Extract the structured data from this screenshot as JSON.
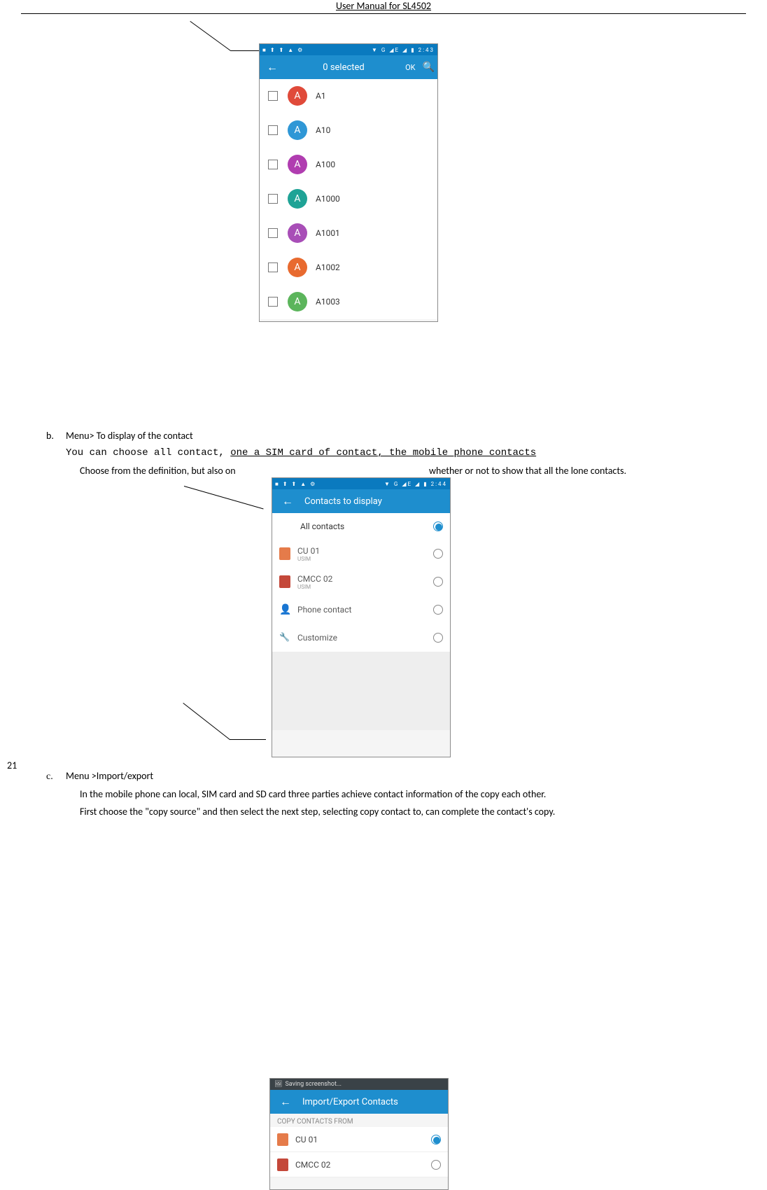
{
  "header": {
    "title": "User Manual for SL4502"
  },
  "pageNumber": "21",
  "section_b": {
    "marker": "b.",
    "heading": "Menu> To display of the contact",
    "line1": "You can choose all contact, ",
    "line1_underlined": "one a SIM card of contact, the mobile phone contacts",
    "line2_start": "Choose from the definition, but also on",
    "line2_end": " whether or not to show that all the lone contacts."
  },
  "section_c": {
    "marker": "c.",
    "heading": "Menu >Import/export",
    "p1": "In the mobile phone can local, SIM card and SD card three parties achieve contact information of the copy each other.",
    "p2": "First choose the \"copy source\" and then select the next step, selecting copy contact to, can complete the contact's copy."
  },
  "phone1": {
    "status_left": "■ ⬆ ⬆ ▲ ⚙",
    "status_right": "▼ G ◢E ◢ ▮ 2:43",
    "appbar": {
      "back": "←",
      "title": "0 selected",
      "ok": "OK",
      "search": "🔍"
    },
    "rows": [
      {
        "color": "#e04a3a",
        "initial": "A",
        "name": "A1"
      },
      {
        "color": "#2f97d6",
        "initial": "A",
        "name": "A10"
      },
      {
        "color": "#b03db0",
        "initial": "A",
        "name": "A100"
      },
      {
        "color": "#1fa396",
        "initial": "A",
        "name": "A1000"
      },
      {
        "color": "#a84eb7",
        "initial": "A",
        "name": "A1001"
      },
      {
        "color": "#e86a2f",
        "initial": "A",
        "name": "A1002"
      },
      {
        "color": "#5cb55c",
        "initial": "A",
        "name": "A1003"
      }
    ]
  },
  "phone2": {
    "status_left": "■ ⬆ ⬆ ▲ ⚙",
    "status_right": "▼ G ◢E ◢ ▮ 2:44",
    "appbar": {
      "back": "←",
      "title": "Contacts to display"
    },
    "rows": [
      {
        "type": "all",
        "label": "All contacts",
        "selected": true
      },
      {
        "type": "sim1",
        "label": "CU 01",
        "sub": "USIM",
        "selected": false
      },
      {
        "type": "sim2",
        "label": "CMCC 02",
        "sub": "USIM",
        "selected": false
      },
      {
        "type": "phone",
        "label": "Phone contact",
        "selected": false
      },
      {
        "type": "custom",
        "label": "Customize",
        "selected": false
      }
    ]
  },
  "phone3": {
    "toast": {
      "icon": "🖼",
      "text": "Saving screenshot..."
    },
    "appbar": {
      "back": "←",
      "title": "Import/Export Contacts"
    },
    "section": "COPY CONTACTS FROM",
    "rows": [
      {
        "type": "sim1",
        "label": "CU 01",
        "selected": true
      },
      {
        "type": "sim2",
        "label": "CMCC 02",
        "selected": false
      }
    ]
  }
}
